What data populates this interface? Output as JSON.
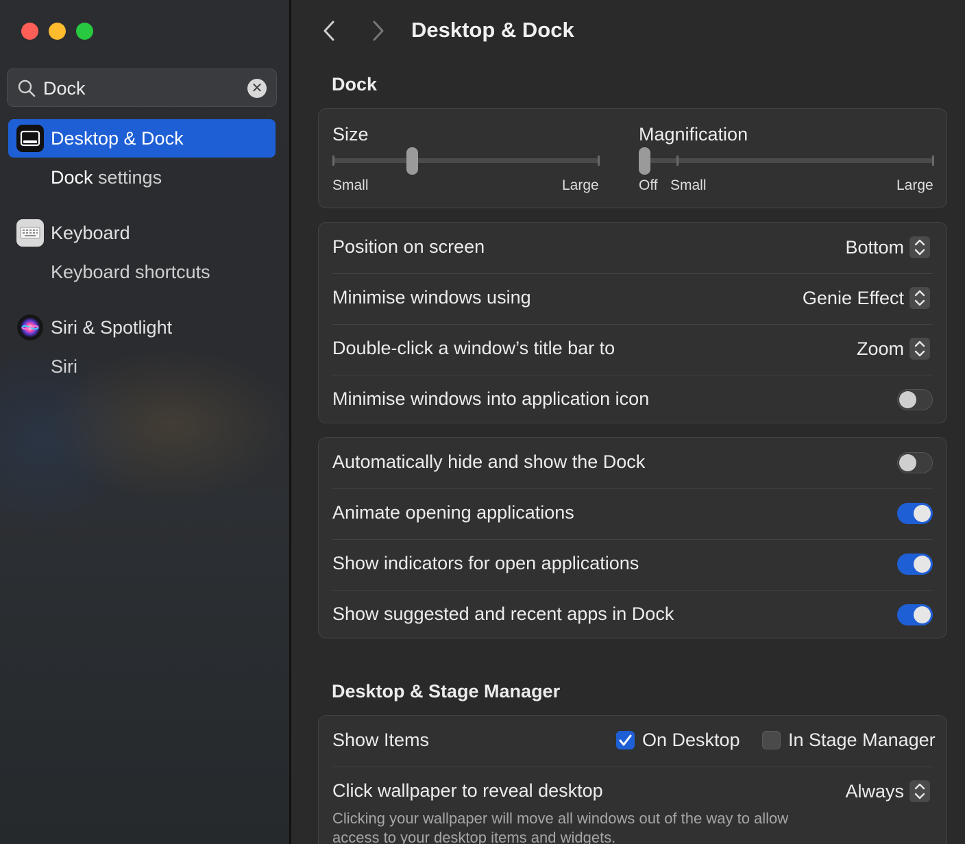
{
  "sidebar": {
    "search": {
      "value": "Dock",
      "placeholder": "Search"
    },
    "items": [
      {
        "label": "Desktop & Dock",
        "icon": "desktop-dock-icon",
        "active": true,
        "sub_prefix": "Dock",
        "sub_suffix": " settings"
      },
      {
        "label": "Keyboard",
        "icon": "keyboard-icon",
        "sub": "Keyboard shortcuts"
      },
      {
        "label": "Siri & Spotlight",
        "icon": "siri-icon",
        "sub": "Siri"
      }
    ]
  },
  "header": {
    "title": "Desktop & Dock"
  },
  "dock": {
    "title": "Dock",
    "size": {
      "label": "Size",
      "min_label": "Small",
      "max_label": "Large",
      "value": 0.29
    },
    "magnification": {
      "label": "Magnification",
      "off_label": "Off",
      "min_label": "Small",
      "max_label": "Large",
      "value": 0.0
    },
    "position": {
      "label": "Position on screen",
      "value": "Bottom"
    },
    "minimise_using": {
      "label": "Minimise windows using",
      "value": "Genie Effect"
    },
    "double_click": {
      "label": "Double-click a window’s title bar to",
      "value": "Zoom"
    },
    "minimise_into_icon": {
      "label": "Minimise windows into application icon",
      "on": false
    },
    "auto_hide": {
      "label": "Automatically hide and show the Dock",
      "on": false
    },
    "animate": {
      "label": "Animate opening applications",
      "on": true
    },
    "indicators": {
      "label": "Show indicators for open applications",
      "on": true
    },
    "suggested": {
      "label": "Show suggested and recent apps in Dock",
      "on": true
    }
  },
  "stage": {
    "title": "Desktop & Stage Manager",
    "show_items": {
      "label": "Show Items",
      "on_desktop": "On Desktop",
      "on_desktop_checked": true,
      "in_stage_manager": "In Stage Manager",
      "in_stage_manager_checked": false
    },
    "click_wallpaper": {
      "label": "Click wallpaper to reveal desktop",
      "value": "Always",
      "description": "Clicking your wallpaper will move all windows out of the way to allow access to your desktop items and widgets."
    }
  },
  "colors": {
    "accent": "#1f5fd6",
    "close": "#ff5f57",
    "minimize": "#febc2e",
    "zoom": "#28c840"
  }
}
